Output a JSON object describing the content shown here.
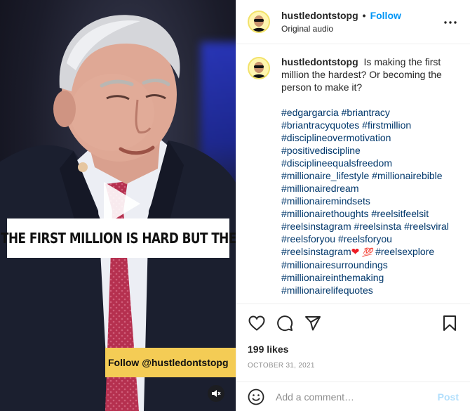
{
  "video": {
    "caption_text": "THE FIRST MILLION IS HARD BUT THE",
    "watermark_text": "Follow @hustledontstopg",
    "play_icon": "play-icon",
    "mute_icon": "speaker-muted-icon"
  },
  "header": {
    "username": "hustledontstopg",
    "separator": "•",
    "follow_label": "Follow",
    "audio_label": "Original audio",
    "more_icon": "more-options-icon"
  },
  "caption": {
    "username": "hustledontstopg",
    "text": "Is making the first million the hardest? Or becoming the person to make it?",
    "hashtag_lines": [
      "#edgargarcia #briantracy",
      "#briantracyquotes #firstmillion",
      "#disciplineovermotivation",
      "#positivediscipline",
      "#disciplineequalsfreedom",
      "#millionaire_lifestyle #millionairebible",
      "#millionairedream",
      "#millionairemindsets",
      "#millionairethoughts #reelsitfeelsit",
      "#reelsinstagram #reelsinsta #reelsviral",
      "#reelsforyou #reelsforyou"
    ],
    "emoji_line": {
      "before": "#reelsinstagram",
      "heart": "❤",
      "hundred": "💯",
      "after": "#reelsexplore"
    },
    "hashtag_lines_end": [
      "#millionairesurroundings",
      "#millionaireinthemaking",
      "#millionairelifequotes"
    ]
  },
  "actions": {
    "icons": [
      "heart-icon",
      "comment-icon",
      "share-icon",
      "bookmark-icon"
    ],
    "likes": "199 likes",
    "date": "OCTOBER 31, 2021"
  },
  "comment_box": {
    "placeholder": "Add a comment…",
    "post_label": "Post",
    "emoji_icon": "smiley-icon"
  },
  "colors": {
    "accent": "#0095f6",
    "hashtag": "#00376b",
    "post_disabled": "#b2dffc",
    "banner_yellow": "#f4cc55"
  }
}
